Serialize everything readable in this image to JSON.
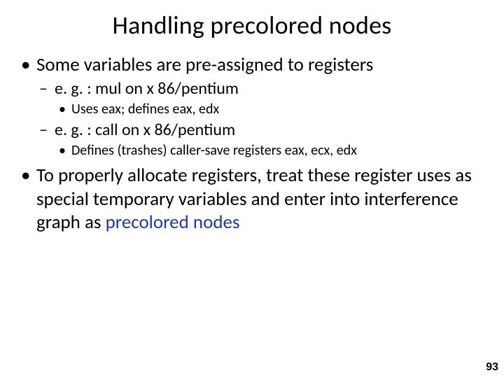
{
  "title": "Handling precolored nodes",
  "bullets": {
    "b1": "Some variables are pre-assigned to registers",
    "b1a": "e. g. : mul on x 86/pentium",
    "b1a1": "Uses eax; defines eax, edx",
    "b1b": "e. g. : call on x 86/pentium",
    "b1b1": "Defines (trashes) caller-save registers eax, ecx, edx",
    "b2_pre": "To properly allocate registers, treat these register uses as special temporary variables and enter into interference graph as ",
    "b2_hl": "precolored nodes"
  },
  "page": "93"
}
